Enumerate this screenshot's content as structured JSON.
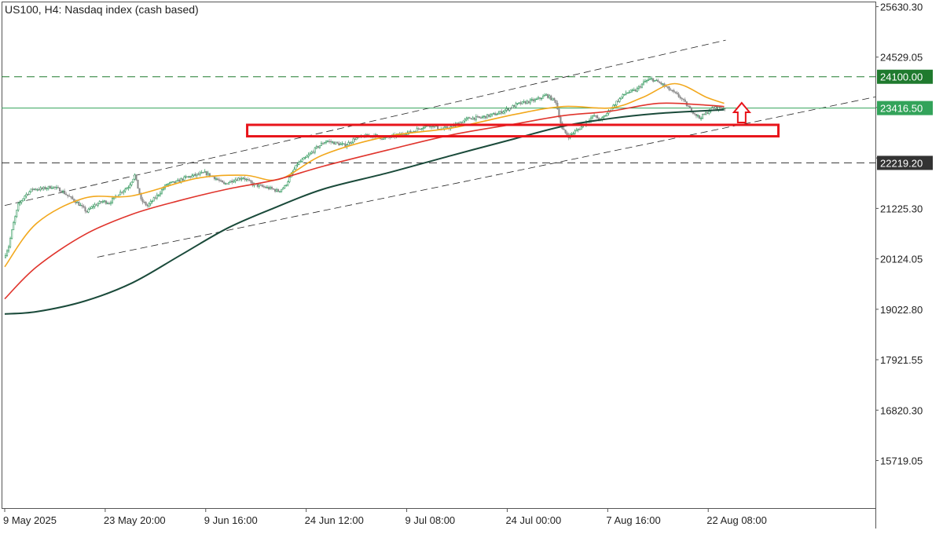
{
  "header": {
    "title": "US100, H4:  Nasdaq index (cash based)"
  },
  "chart_data": {
    "type": "candlestick",
    "symbol": "US100",
    "timeframe": "H4",
    "instrument": "Nasdaq index (cash based)",
    "ylim": [
      14650,
      25630.3
    ],
    "y_ticks": [
      25630.3,
      24529.05,
      23427.8,
      22326.55,
      21225.3,
      20124.05,
      19022.8,
      17921.55,
      16820.3,
      15719.05
    ],
    "y_tick_labels": [
      "25630.30",
      "24529.05",
      "",
      "",
      "21225.30",
      "20124.05",
      "19022.80",
      "17921.55",
      "16820.30",
      "15719.05"
    ],
    "x_ticks": [
      {
        "label": "9 May 2025",
        "bar": 0
      },
      {
        "label": "23 May 20:00",
        "bar": 63
      },
      {
        "label": "9 Jun 16:00",
        "bar": 126
      },
      {
        "label": "24 Jun 12:00",
        "bar": 189
      },
      {
        "label": "9 Jul 08:00",
        "bar": 252
      },
      {
        "label": "24 Jul 00:00",
        "bar": 315
      },
      {
        "label": "7 Aug 16:00",
        "bar": 378
      },
      {
        "label": "22 Aug 08:00",
        "bar": 441
      }
    ],
    "total_bars": 452,
    "price_path": [
      [
        0,
        20150
      ],
      [
        3,
        20400
      ],
      [
        6,
        20900
      ],
      [
        9,
        21300
      ],
      [
        13,
        21500
      ],
      [
        18,
        21650
      ],
      [
        24,
        21650
      ],
      [
        30,
        21700
      ],
      [
        36,
        21620
      ],
      [
        40,
        21500
      ],
      [
        46,
        21350
      ],
      [
        52,
        21150
      ],
      [
        56,
        21280
      ],
      [
        62,
        21380
      ],
      [
        66,
        21350
      ],
      [
        72,
        21550
      ],
      [
        78,
        21700
      ],
      [
        82,
        21950
      ],
      [
        86,
        21400
      ],
      [
        90,
        21280
      ],
      [
        96,
        21500
      ],
      [
        102,
        21750
      ],
      [
        108,
        21800
      ],
      [
        114,
        21900
      ],
      [
        120,
        21950
      ],
      [
        126,
        22000
      ],
      [
        132,
        21900
      ],
      [
        138,
        21750
      ],
      [
        144,
        21850
      ],
      [
        150,
        21900
      ],
      [
        156,
        21750
      ],
      [
        162,
        21700
      ],
      [
        168,
        21650
      ],
      [
        172,
        21600
      ],
      [
        176,
        21700
      ],
      [
        180,
        21950
      ],
      [
        184,
        22200
      ],
      [
        190,
        22350
      ],
      [
        196,
        22550
      ],
      [
        202,
        22700
      ],
      [
        208,
        22650
      ],
      [
        214,
        22600
      ],
      [
        220,
        22750
      ],
      [
        226,
        22800
      ],
      [
        232,
        22820
      ],
      [
        238,
        22750
      ],
      [
        244,
        22800
      ],
      [
        250,
        22850
      ],
      [
        256,
        22900
      ],
      [
        262,
        23000
      ],
      [
        268,
        23050
      ],
      [
        274,
        22950
      ],
      [
        280,
        23000
      ],
      [
        286,
        23100
      ],
      [
        292,
        23200
      ],
      [
        298,
        23200
      ],
      [
        304,
        23250
      ],
      [
        310,
        23300
      ],
      [
        316,
        23400
      ],
      [
        322,
        23500
      ],
      [
        328,
        23550
      ],
      [
        334,
        23600
      ],
      [
        340,
        23700
      ],
      [
        346,
        23550
      ],
      [
        350,
        22950
      ],
      [
        354,
        22800
      ],
      [
        358,
        22900
      ],
      [
        362,
        23000
      ],
      [
        366,
        23150
      ],
      [
        370,
        23250
      ],
      [
        374,
        23150
      ],
      [
        378,
        23300
      ],
      [
        384,
        23550
      ],
      [
        390,
        23750
      ],
      [
        396,
        23800
      ],
      [
        402,
        24000
      ],
      [
        406,
        24050
      ],
      [
        412,
        23950
      ],
      [
        418,
        23800
      ],
      [
        424,
        23650
      ],
      [
        430,
        23400
      ],
      [
        436,
        23200
      ],
      [
        440,
        23300
      ],
      [
        444,
        23420
      ],
      [
        448,
        23417
      ],
      [
        451,
        23420
      ]
    ],
    "moving_averages": [
      {
        "color": "#f2a81d",
        "points": [
          [
            0,
            19950
          ],
          [
            20,
            20900
          ],
          [
            50,
            21450
          ],
          [
            80,
            21500
          ],
          [
            120,
            21880
          ],
          [
            150,
            21950
          ],
          [
            172,
            21860
          ],
          [
            200,
            22400
          ],
          [
            240,
            22800
          ],
          [
            280,
            22980
          ],
          [
            320,
            23280
          ],
          [
            350,
            23450
          ],
          [
            380,
            23420
          ],
          [
            400,
            23650
          ],
          [
            420,
            23950
          ],
          [
            440,
            23650
          ],
          [
            451,
            23520
          ]
        ]
      },
      {
        "color": "#e0342c",
        "points": [
          [
            0,
            19250
          ],
          [
            20,
            19950
          ],
          [
            50,
            20650
          ],
          [
            80,
            21100
          ],
          [
            110,
            21400
          ],
          [
            140,
            21650
          ],
          [
            170,
            21850
          ],
          [
            200,
            22150
          ],
          [
            240,
            22500
          ],
          [
            280,
            22830
          ],
          [
            320,
            23070
          ],
          [
            350,
            23250
          ],
          [
            380,
            23350
          ],
          [
            410,
            23520
          ],
          [
            440,
            23480
          ],
          [
            451,
            23450
          ]
        ]
      },
      {
        "color": "#1a4a3a",
        "points": [
          [
            0,
            18920
          ],
          [
            20,
            18970
          ],
          [
            50,
            19200
          ],
          [
            80,
            19600
          ],
          [
            110,
            20200
          ],
          [
            140,
            20800
          ],
          [
            170,
            21250
          ],
          [
            200,
            21650
          ],
          [
            240,
            22000
          ],
          [
            280,
            22380
          ],
          [
            320,
            22750
          ],
          [
            350,
            23020
          ],
          [
            380,
            23190
          ],
          [
            410,
            23300
          ],
          [
            440,
            23360
          ],
          [
            451,
            23380
          ]
        ]
      }
    ],
    "horizontal_levels": [
      {
        "value": 24100.0,
        "label": "24100.00",
        "style": "dashed",
        "color": "#1f7a2e"
      },
      {
        "value": 23416.5,
        "label": "23416.50",
        "style": "solid",
        "color": "#33a35a"
      },
      {
        "value": 22219.2,
        "label": "22219.20",
        "style": "dashed",
        "color": "#333333"
      }
    ],
    "channel_lines": [
      {
        "from": [
          0,
          21290
        ],
        "to": [
          452,
          24900
        ]
      },
      {
        "from": [
          58,
          20160
        ],
        "to": [
          550,
          23690
        ]
      }
    ],
    "zone": {
      "bar_start": 152,
      "bar_end": 485,
      "top": 23050,
      "bottom": 22800,
      "color": "#e8141a"
    },
    "arrow": {
      "bar": 462,
      "direction": "up",
      "value_tip": 23530,
      "value_base": 23100,
      "color": "#e8141a"
    }
  }
}
